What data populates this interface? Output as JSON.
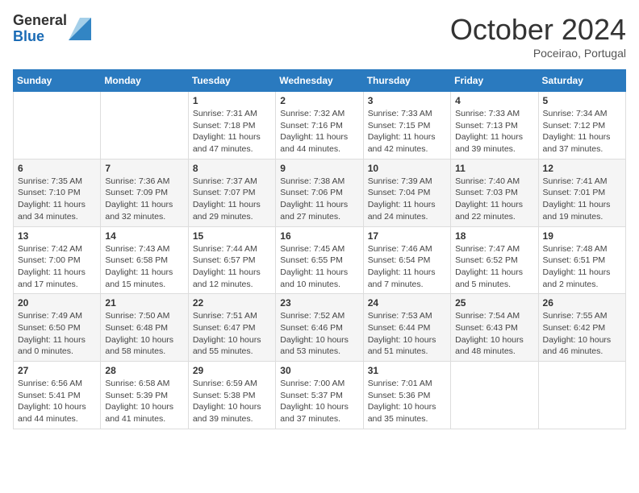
{
  "header": {
    "logo_general": "General",
    "logo_blue": "Blue",
    "month_title": "October 2024",
    "location": "Poceirao, Portugal"
  },
  "days_of_week": [
    "Sunday",
    "Monday",
    "Tuesday",
    "Wednesday",
    "Thursday",
    "Friday",
    "Saturday"
  ],
  "weeks": [
    [
      {
        "day": "",
        "info": ""
      },
      {
        "day": "",
        "info": ""
      },
      {
        "day": "1",
        "info": "Sunrise: 7:31 AM\nSunset: 7:18 PM\nDaylight: 11 hours and 47 minutes."
      },
      {
        "day": "2",
        "info": "Sunrise: 7:32 AM\nSunset: 7:16 PM\nDaylight: 11 hours and 44 minutes."
      },
      {
        "day": "3",
        "info": "Sunrise: 7:33 AM\nSunset: 7:15 PM\nDaylight: 11 hours and 42 minutes."
      },
      {
        "day": "4",
        "info": "Sunrise: 7:33 AM\nSunset: 7:13 PM\nDaylight: 11 hours and 39 minutes."
      },
      {
        "day": "5",
        "info": "Sunrise: 7:34 AM\nSunset: 7:12 PM\nDaylight: 11 hours and 37 minutes."
      }
    ],
    [
      {
        "day": "6",
        "info": "Sunrise: 7:35 AM\nSunset: 7:10 PM\nDaylight: 11 hours and 34 minutes."
      },
      {
        "day": "7",
        "info": "Sunrise: 7:36 AM\nSunset: 7:09 PM\nDaylight: 11 hours and 32 minutes."
      },
      {
        "day": "8",
        "info": "Sunrise: 7:37 AM\nSunset: 7:07 PM\nDaylight: 11 hours and 29 minutes."
      },
      {
        "day": "9",
        "info": "Sunrise: 7:38 AM\nSunset: 7:06 PM\nDaylight: 11 hours and 27 minutes."
      },
      {
        "day": "10",
        "info": "Sunrise: 7:39 AM\nSunset: 7:04 PM\nDaylight: 11 hours and 24 minutes."
      },
      {
        "day": "11",
        "info": "Sunrise: 7:40 AM\nSunset: 7:03 PM\nDaylight: 11 hours and 22 minutes."
      },
      {
        "day": "12",
        "info": "Sunrise: 7:41 AM\nSunset: 7:01 PM\nDaylight: 11 hours and 19 minutes."
      }
    ],
    [
      {
        "day": "13",
        "info": "Sunrise: 7:42 AM\nSunset: 7:00 PM\nDaylight: 11 hours and 17 minutes."
      },
      {
        "day": "14",
        "info": "Sunrise: 7:43 AM\nSunset: 6:58 PM\nDaylight: 11 hours and 15 minutes."
      },
      {
        "day": "15",
        "info": "Sunrise: 7:44 AM\nSunset: 6:57 PM\nDaylight: 11 hours and 12 minutes."
      },
      {
        "day": "16",
        "info": "Sunrise: 7:45 AM\nSunset: 6:55 PM\nDaylight: 11 hours and 10 minutes."
      },
      {
        "day": "17",
        "info": "Sunrise: 7:46 AM\nSunset: 6:54 PM\nDaylight: 11 hours and 7 minutes."
      },
      {
        "day": "18",
        "info": "Sunrise: 7:47 AM\nSunset: 6:52 PM\nDaylight: 11 hours and 5 minutes."
      },
      {
        "day": "19",
        "info": "Sunrise: 7:48 AM\nSunset: 6:51 PM\nDaylight: 11 hours and 2 minutes."
      }
    ],
    [
      {
        "day": "20",
        "info": "Sunrise: 7:49 AM\nSunset: 6:50 PM\nDaylight: 11 hours and 0 minutes."
      },
      {
        "day": "21",
        "info": "Sunrise: 7:50 AM\nSunset: 6:48 PM\nDaylight: 10 hours and 58 minutes."
      },
      {
        "day": "22",
        "info": "Sunrise: 7:51 AM\nSunset: 6:47 PM\nDaylight: 10 hours and 55 minutes."
      },
      {
        "day": "23",
        "info": "Sunrise: 7:52 AM\nSunset: 6:46 PM\nDaylight: 10 hours and 53 minutes."
      },
      {
        "day": "24",
        "info": "Sunrise: 7:53 AM\nSunset: 6:44 PM\nDaylight: 10 hours and 51 minutes."
      },
      {
        "day": "25",
        "info": "Sunrise: 7:54 AM\nSunset: 6:43 PM\nDaylight: 10 hours and 48 minutes."
      },
      {
        "day": "26",
        "info": "Sunrise: 7:55 AM\nSunset: 6:42 PM\nDaylight: 10 hours and 46 minutes."
      }
    ],
    [
      {
        "day": "27",
        "info": "Sunrise: 6:56 AM\nSunset: 5:41 PM\nDaylight: 10 hours and 44 minutes."
      },
      {
        "day": "28",
        "info": "Sunrise: 6:58 AM\nSunset: 5:39 PM\nDaylight: 10 hours and 41 minutes."
      },
      {
        "day": "29",
        "info": "Sunrise: 6:59 AM\nSunset: 5:38 PM\nDaylight: 10 hours and 39 minutes."
      },
      {
        "day": "30",
        "info": "Sunrise: 7:00 AM\nSunset: 5:37 PM\nDaylight: 10 hours and 37 minutes."
      },
      {
        "day": "31",
        "info": "Sunrise: 7:01 AM\nSunset: 5:36 PM\nDaylight: 10 hours and 35 minutes."
      },
      {
        "day": "",
        "info": ""
      },
      {
        "day": "",
        "info": ""
      }
    ]
  ]
}
